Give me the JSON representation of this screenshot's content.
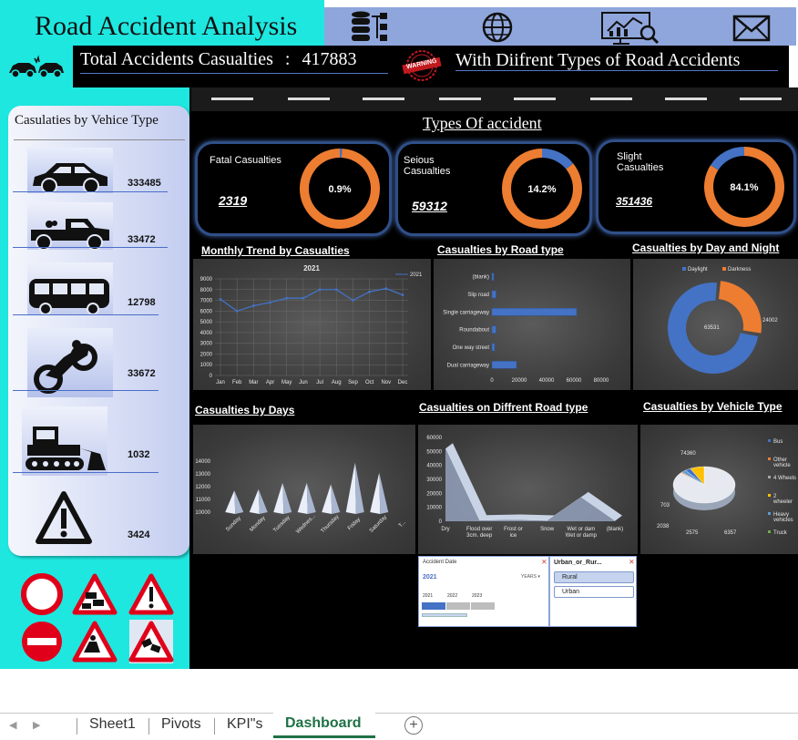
{
  "header": {
    "title": "Road Accident Analysis",
    "totals_label": "Total Accidents Casualties",
    "totals_separator": ":",
    "totals_value": "417883",
    "warning_stamp": "WARNING",
    "types_text": "With Diifrent Types of Road Accidents",
    "icons": [
      "database-icon",
      "globe-icon",
      "analytics-monitor-icon",
      "mail-icon"
    ]
  },
  "vehicle_panel": {
    "title": "Casulaties by Vehice Type",
    "items": [
      {
        "icon": "car-icon",
        "value": "333485"
      },
      {
        "icon": "pickup-truck-icon",
        "value": "33472"
      },
      {
        "icon": "bus-icon",
        "value": "12798"
      },
      {
        "icon": "motorcycle-icon",
        "value": "33672"
      },
      {
        "icon": "bulldozer-icon",
        "value": "1032"
      },
      {
        "icon": "warning-triangle-icon",
        "value": "3424"
      }
    ]
  },
  "types_title": "Types Of accident",
  "kpis": [
    {
      "label": "Fatal Casualties",
      "value": "2319",
      "percent_label": "0.9%",
      "percent": 0.9
    },
    {
      "label": "Seious Casualties",
      "value": "59312",
      "percent_label": "14.2%",
      "percent": 14.2
    },
    {
      "label": "Slight Casualties",
      "value": "351436",
      "percent_label": "84.1%",
      "percent": 84.1
    }
  ],
  "sections": {
    "monthly": "Monthly Trend by Casualties",
    "road_type": "Casualties by Road type",
    "day_night": "Casualties by Day and Night",
    "days": "Casualties by Days",
    "road_surface": "Casualties on Diffrent Road type",
    "vehicle_type": "Casualties by Vehicle Type"
  },
  "colors": {
    "cyan": "#1ee7e0",
    "blue": "#4472c4",
    "orange": "#ed7d31",
    "gray": "#a5a5a5",
    "yellow": "#ffc000",
    "steel": "#5b9bd5",
    "green": "#70ad47"
  },
  "chart_data": [
    {
      "type": "line",
      "title": "2021",
      "legend": "2021",
      "categories": [
        "Jan",
        "Feb",
        "Mar",
        "Apr",
        "May",
        "Jun",
        "Jul",
        "Aug",
        "Sep",
        "Oct",
        "Nov",
        "Dec"
      ],
      "series": [
        {
          "name": "2021",
          "values": [
            7100,
            6000,
            6500,
            6800,
            7200,
            7200,
            8000,
            8000,
            7000,
            7800,
            8100,
            7500
          ]
        }
      ],
      "ylim": [
        0,
        9000
      ],
      "yticks": [
        "0",
        "1000",
        "2000",
        "3000",
        "4000",
        "5000",
        "6000",
        "7000",
        "8000",
        "9000"
      ],
      "grid": true,
      "legend_position": "top-right"
    },
    {
      "type": "bar",
      "orientation": "horizontal",
      "categories": [
        "(blank)",
        "Slip road",
        "Single carriageway",
        "Roundabout",
        "One way street",
        "Dual carriageway"
      ],
      "values": [
        800,
        3000,
        62000,
        3000,
        2000,
        18000
      ],
      "xlim": [
        0,
        80000
      ],
      "xticks": [
        "0",
        "20000",
        "40000",
        "60000",
        "80000"
      ]
    },
    {
      "type": "pie",
      "style": "doughnut",
      "categories": [
        "Daylight",
        "Darkness"
      ],
      "values": [
        63531,
        24002
      ],
      "value_labels": [
        "63531",
        "24002"
      ],
      "legend_position": "top"
    },
    {
      "type": "bar",
      "style": "3d-cone",
      "categories": [
        "Sunday",
        "Monday",
        "Tuesday",
        "Wednes...",
        "Thursday",
        "Friday",
        "Saturday",
        "T..."
      ],
      "values": [
        11700,
        11800,
        12300,
        12300,
        12200,
        13900,
        13100,
        10000
      ],
      "ylim": [
        10000,
        14000
      ],
      "yticks": [
        "10000",
        "11000",
        "12000",
        "13000",
        "14000"
      ]
    },
    {
      "type": "area",
      "style": "3d",
      "categories": [
        "Dry",
        "Flood over 3cm. deep",
        "Frost or ice",
        "Snow",
        "Wet or damp",
        "(blank)"
      ],
      "values": [
        52000,
        500,
        1000,
        300,
        17000,
        200
      ],
      "ylim": [
        0,
        60000
      ],
      "yticks": [
        "0",
        "10000",
        "20000",
        "30000",
        "40000",
        "50000",
        "60000"
      ]
    },
    {
      "type": "pie",
      "style": "3d",
      "categories": [
        "Bus",
        "Other vehicle",
        "4 Wheels",
        "2 wheeler",
        "Heavy vehicles",
        "Truck"
      ],
      "values": [
        2575,
        703,
        74360,
        6357,
        2038,
        0
      ],
      "value_labels": [
        "74360",
        "703",
        "2038",
        "2575",
        "6357"
      ],
      "legend_position": "right"
    }
  ],
  "slicers": {
    "date": {
      "title": "Accident Date",
      "selected": "2021",
      "unit": "YEARS",
      "years": [
        "2021",
        "2022",
        "2023"
      ]
    },
    "urban": {
      "title": "Urban_or_Rur...",
      "options": [
        "Rural",
        "Urban"
      ]
    }
  },
  "sheet_tabs": [
    "Sheet1",
    "Pivots",
    "KPI\"s",
    "Dashboard"
  ],
  "active_tab": "Dashboard"
}
